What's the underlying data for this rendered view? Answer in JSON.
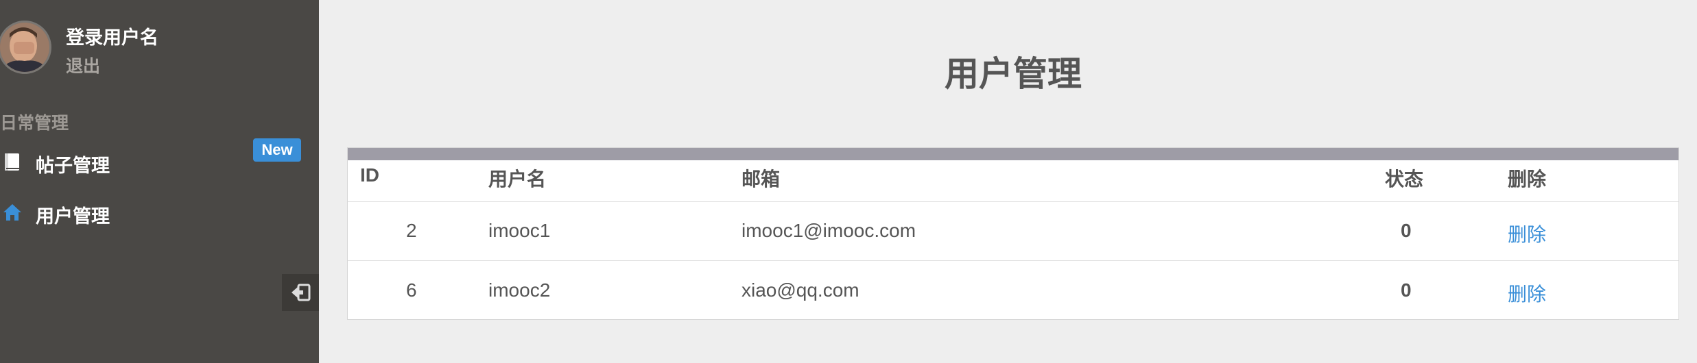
{
  "sidebar": {
    "username": "登录用户名",
    "logout": "退出",
    "section_title": "日常管理",
    "items": [
      {
        "label": "帖子管理",
        "icon": "book-icon",
        "badge": "New"
      },
      {
        "label": "用户管理",
        "icon": "home-icon"
      }
    ],
    "collapse_icon": "sign-out-icon"
  },
  "main": {
    "title": "用户管理",
    "table": {
      "headers": [
        "ID",
        "用户名",
        "邮箱",
        "状态",
        "删除"
      ],
      "rows": [
        {
          "id": "2",
          "username": "imooc1",
          "email": "imooc1@imooc.com",
          "status": "0",
          "action": "删除"
        },
        {
          "id": "6",
          "username": "imooc2",
          "email": "xiao@qq.com",
          "status": "0",
          "action": "删除"
        }
      ]
    }
  },
  "colors": {
    "sidebar_bg": "#4a4845",
    "page_bg": "#eeeeee",
    "accent": "#3a8fd8",
    "table_topbar": "#9e9ca6"
  }
}
